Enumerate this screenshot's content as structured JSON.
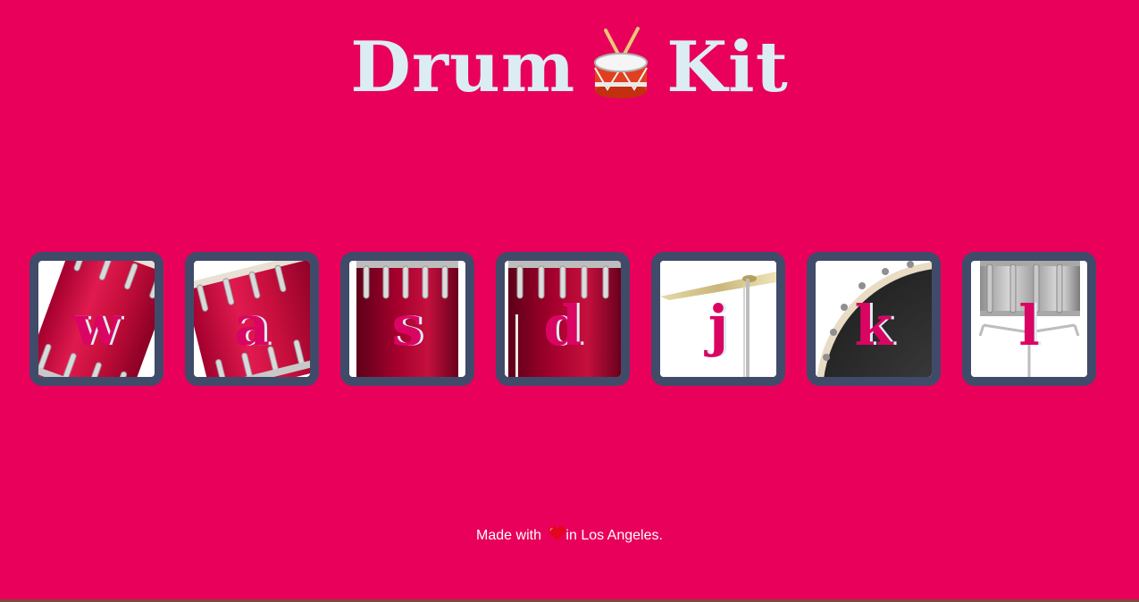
{
  "header": {
    "title_left": "Drum",
    "title_right": "Kit",
    "title_icon": "drum-emoji-icon"
  },
  "drums": [
    {
      "key": "w",
      "instrument": "tom-1",
      "icon": "tom-drum-icon"
    },
    {
      "key": "a",
      "instrument": "tom-2",
      "icon": "tom-drum-icon"
    },
    {
      "key": "s",
      "instrument": "tom-3",
      "icon": "tom-drum-icon"
    },
    {
      "key": "d",
      "instrument": "tom-4",
      "icon": "tom-drum-icon"
    },
    {
      "key": "j",
      "instrument": "crash",
      "icon": "cymbal-icon"
    },
    {
      "key": "k",
      "instrument": "kick-bass",
      "icon": "kick-drum-icon"
    },
    {
      "key": "l",
      "instrument": "snare",
      "icon": "snare-drum-icon"
    }
  ],
  "footer": {
    "prefix": "Made with ",
    "suffix": "in Los Angeles.",
    "icon": "heart-icon"
  },
  "colors": {
    "background": "#E9005B",
    "title": "#DBEDF3",
    "drum_border": "#404B69",
    "key_letter": "#DA0463"
  }
}
